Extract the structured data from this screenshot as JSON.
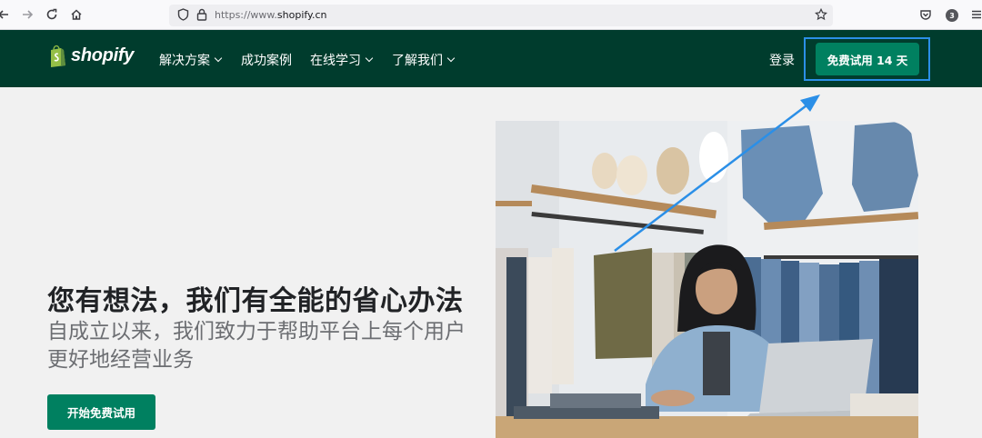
{
  "browser": {
    "url_prefix": "https://www.",
    "url_domain": "shopify.cn",
    "badge_count": "3",
    "icons": [
      "back-icon",
      "forward-icon",
      "reload-icon",
      "home-icon",
      "shield-icon",
      "lock-icon",
      "star-icon",
      "pocket-icon",
      "menu-icon"
    ]
  },
  "nav": {
    "logo_text": "shopify",
    "items": [
      {
        "label": "解决方案",
        "dropdown": true
      },
      {
        "label": "成功案例",
        "dropdown": false
      },
      {
        "label": "在线学习",
        "dropdown": true
      },
      {
        "label": "了解我们",
        "dropdown": true
      }
    ],
    "login": "登录",
    "trial_button": "免费试用 14 天"
  },
  "hero": {
    "title": "您有想法，我们有全能的省心办法",
    "subtitle": "自成立以来，我们致力于帮助平台上每个用户更好地经营业务",
    "cta": "开始免费试用"
  },
  "colors": {
    "nav_bg": "#003c2d",
    "brand_green": "#008060",
    "logo_green": "#95bf47",
    "annotation_blue": "#2b8fe7"
  }
}
